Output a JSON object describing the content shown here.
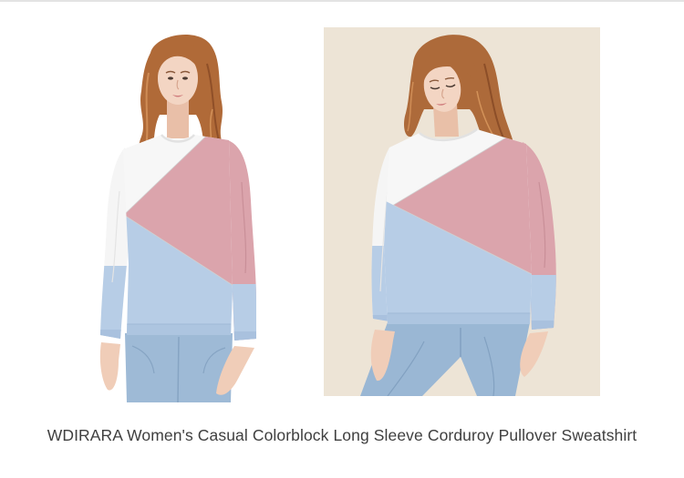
{
  "product": {
    "title": "WDIRARA Women's Casual Colorblock Long Sleeve Corduroy Pullover Sweatshirt"
  },
  "colors": {
    "title_text": "#3f3f3f",
    "divider": "#e3e3e3",
    "photo_background": "#ede4d6",
    "block_white": "#f7f7f7",
    "block_pink": "#dba4ac",
    "block_blue": "#b7cde6"
  }
}
